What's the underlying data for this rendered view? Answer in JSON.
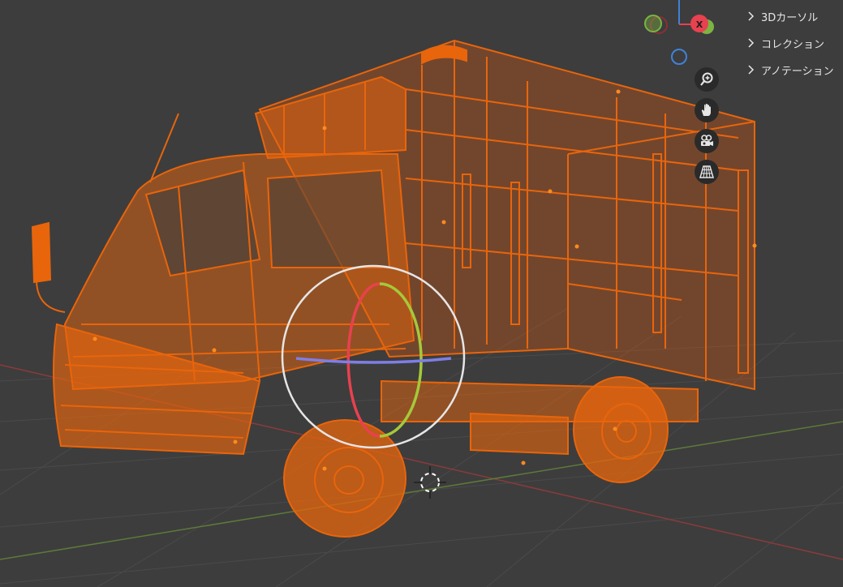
{
  "sidebar": {
    "items": [
      {
        "label": "3Dカーソル",
        "icon": "chevron-right-icon"
      },
      {
        "label": "コレクション",
        "icon": "chevron-right-icon"
      },
      {
        "label": "アノテーション",
        "icon": "chevron-right-icon"
      }
    ]
  },
  "gizmo": {
    "x_label": "X",
    "colors": {
      "x": "#e8414f",
      "y": "#7cb342",
      "z": "#3f82d9"
    }
  },
  "nav_buttons": [
    {
      "name": "zoom",
      "icon": "zoom-icon"
    },
    {
      "name": "pan",
      "icon": "hand-icon"
    },
    {
      "name": "camera",
      "icon": "camera-icon"
    },
    {
      "name": "perspective",
      "icon": "grid-icon"
    }
  ],
  "colors": {
    "background": "#3d3d3d",
    "wireframe": "#e8650c",
    "selection": "#ff8a1f"
  }
}
